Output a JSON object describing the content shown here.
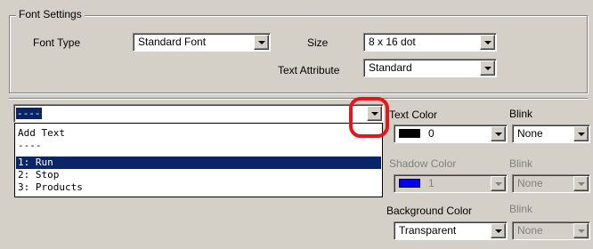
{
  "font_settings": {
    "group_title": "Font Settings",
    "font_type": {
      "label": "Font Type",
      "value": "Standard Font"
    },
    "size": {
      "label": "Size",
      "value": "8 x 16 dot"
    },
    "text_attribute": {
      "label": "Text Attribute",
      "value": "Standard"
    }
  },
  "text_combo": {
    "value": "----",
    "options": [
      {
        "label": "Add Text",
        "selected": false
      },
      {
        "label": "----",
        "selected": false
      },
      {
        "label": "1: Run",
        "selected": true
      },
      {
        "label": "2: Stop",
        "selected": false
      },
      {
        "label": "3: Products",
        "selected": false
      }
    ]
  },
  "text_color": {
    "label": "Text Color",
    "value": "0",
    "swatch": "#000000"
  },
  "text_blink": {
    "label": "Blink",
    "value": "None"
  },
  "shadow_color": {
    "label": "Shadow Color",
    "value": "1",
    "swatch": "#0000ff"
  },
  "shadow_blink": {
    "label": "Blink",
    "value": "None"
  },
  "background_color": {
    "label": "Background Color",
    "value": "Transparent"
  },
  "background_blink": {
    "label": "Blink",
    "value": "None"
  },
  "colors": {
    "highlight": "#0a246a",
    "callout": "#e8141b"
  }
}
